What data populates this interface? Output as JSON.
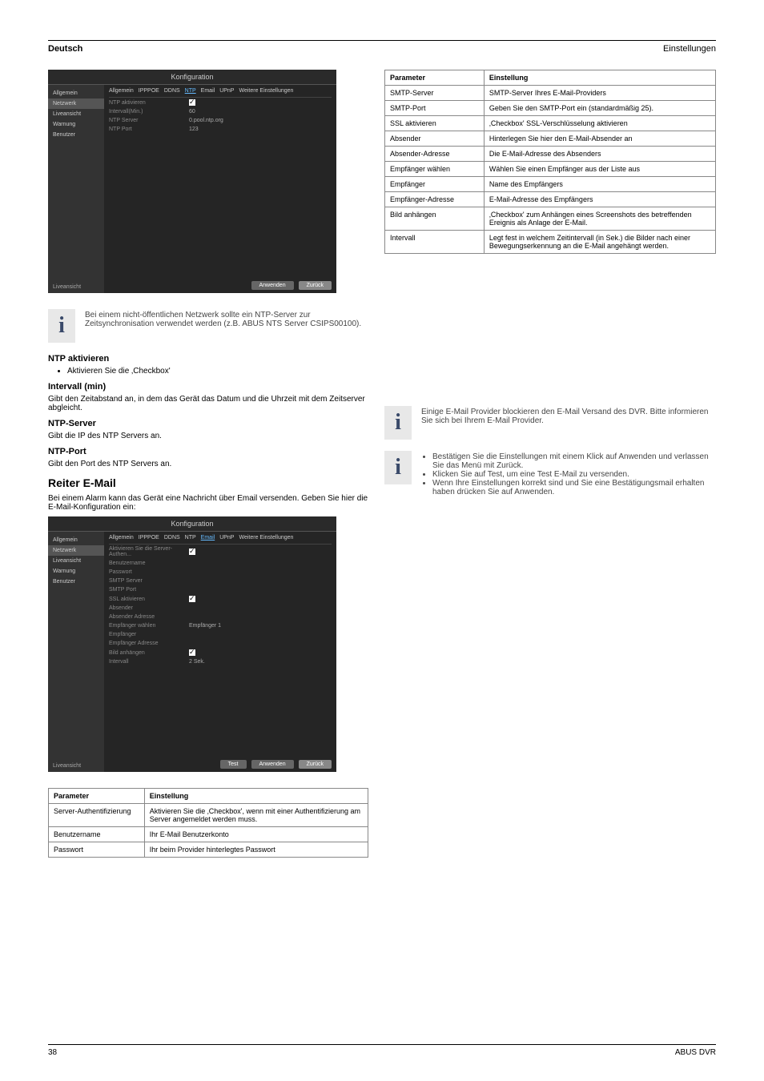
{
  "header": {
    "german": "Deutsch",
    "section": "Einstellungen"
  },
  "footer": {
    "page": "38",
    "product": "ABUS DVR"
  },
  "infoIcon": "i",
  "ntp": {
    "shotTitle": "Konfiguration",
    "sidebar": [
      "Allgemein",
      "Netzwerk",
      "Liveansicht",
      "Warnung",
      "Benutzer"
    ],
    "tabs": [
      "Allgemein",
      "IPPPOE",
      "DDNS",
      "NTP",
      "Email",
      "UPnP",
      "Weitere Einstellungen"
    ],
    "rows": [
      {
        "label": "NTP aktivieren",
        "checkbox": true
      },
      {
        "label": "Intervall(Min.)",
        "value": "60"
      },
      {
        "label": "NTP Server",
        "value": "0.pool.ntp.org"
      },
      {
        "label": "NTP Port",
        "value": "123"
      }
    ],
    "btnApply": "Anwenden",
    "btnBack": "Zurück",
    "liveLabel": "Liveansicht",
    "infoText": "Bei einem nicht-öffentlichen Netzwerk sollte ein NTP-Server zur Zeitsynchronisation verwendet werden (z.B. ABUS NTS Server CSIPS00100).",
    "enable": {
      "head": "NTP aktivieren",
      "text": "Aktivieren Sie die ‚Checkbox'"
    },
    "interval": {
      "head": "Intervall (min)",
      "text": "Gibt den Zeitabstand an, in dem das Gerät das Datum und die Uhrzeit mit dem Zeitserver abgleicht."
    },
    "server": {
      "head": "NTP-Server",
      "text": "Gibt die IP des NTP Servers an."
    },
    "port": {
      "head": "NTP-Port",
      "text": "Gibt den Port des NTP Servers an."
    }
  },
  "emailSection": {
    "title": "Reiter E-Mail",
    "intro": "Bei einem Alarm kann das Gerät eine Nachricht über Email versenden. Geben Sie hier die E-Mail-Konfiguration ein:",
    "shotTitle": "Konfiguration",
    "sidebar": [
      "Allgemein",
      "Netzwerk",
      "Liveansicht",
      "Warnung",
      "Benutzer"
    ],
    "tabs": [
      "Allgemein",
      "IPPPOE",
      "DDNS",
      "NTP",
      "Email",
      "UPnP",
      "Weitere Einstellungen"
    ],
    "rows": [
      {
        "label": "Aktivieren Sie die Server-Authen...",
        "checkbox": true
      },
      {
        "label": "Benutzername",
        "value": ""
      },
      {
        "label": "Passwort",
        "value": ""
      },
      {
        "label": "SMTP Server",
        "value": ""
      },
      {
        "label": "SMTP Port",
        "value": ""
      },
      {
        "label": "SSL aktivieren",
        "checkbox": true
      },
      {
        "label": "Absender",
        "value": ""
      },
      {
        "label": "Absender Adresse",
        "value": ""
      },
      {
        "label": "Empfänger wählen",
        "value": "Empfänger 1"
      },
      {
        "label": "Empfänger",
        "value": ""
      },
      {
        "label": "Empfänger Adresse",
        "value": ""
      },
      {
        "label": "Bild anhängen",
        "checkbox": true
      },
      {
        "label": "Intervall",
        "value": "2 Sek."
      }
    ],
    "btnTest": "Test",
    "btnApply": "Anwenden",
    "btnBack": "Zurück",
    "liveLabel": "Liveansicht",
    "table1": {
      "head": [
        "Parameter",
        "Einstellung"
      ],
      "rows": [
        [
          "Server-Authentifizierung",
          "Aktivieren Sie die ‚Checkbox', wenn mit einer Authentifizierung am Server angemeldet werden muss."
        ],
        [
          "Benutzername",
          "Ihr E-Mail Benutzerkonto"
        ],
        [
          "Passwort",
          "Ihr beim Provider hinterlegtes Passwort"
        ]
      ]
    },
    "table2": {
      "head": [
        "Parameter",
        "Einstellung"
      ],
      "rows": [
        [
          "SMTP-Server",
          "SMTP-Server Ihres E-Mail-Providers"
        ],
        [
          "SMTP-Port",
          "Geben Sie den SMTP-Port ein (standardmäßig 25)."
        ],
        [
          "SSL aktivieren",
          "‚Checkbox' SSL-Verschlüsselung aktivieren"
        ],
        [
          "Absender",
          "Hinterlegen Sie hier den E-Mail-Absender an"
        ],
        [
          "Absender-Adresse",
          "Die E-Mail-Adresse des Absenders"
        ],
        [
          "Empfänger wählen",
          "Wählen Sie einen Empfänger aus der Liste aus"
        ],
        [
          "Empfänger",
          "Name des Empfängers"
        ],
        [
          "Empfänger-Adresse",
          "E-Mail-Adresse des Empfängers"
        ],
        [
          "Bild anhängen",
          "‚Checkbox' zum Anhängen eines Screenshots des betreffenden Ereignis als Anlage der E-Mail."
        ],
        [
          "Intervall",
          "Legt fest in welchem Zeitintervall (in Sek.) die Bilder nach einer Bewegungserkennung an die E-Mail angehängt werden."
        ]
      ]
    },
    "info1": "Einige E-Mail Provider blockieren den E-Mail Versand des DVR. Bitte informieren Sie sich bei Ihrem E-Mail Provider.",
    "info2": [
      "Bestätigen Sie die Einstellungen mit einem Klick auf Anwenden und verlassen Sie das Menü mit Zurück.",
      "Klicken Sie auf Test, um eine Test E-Mail zu versenden.",
      "Wenn Ihre Einstellungen korrekt sind und Sie eine Bestätigungsmail erhalten haben drücken Sie auf Anwenden."
    ]
  }
}
